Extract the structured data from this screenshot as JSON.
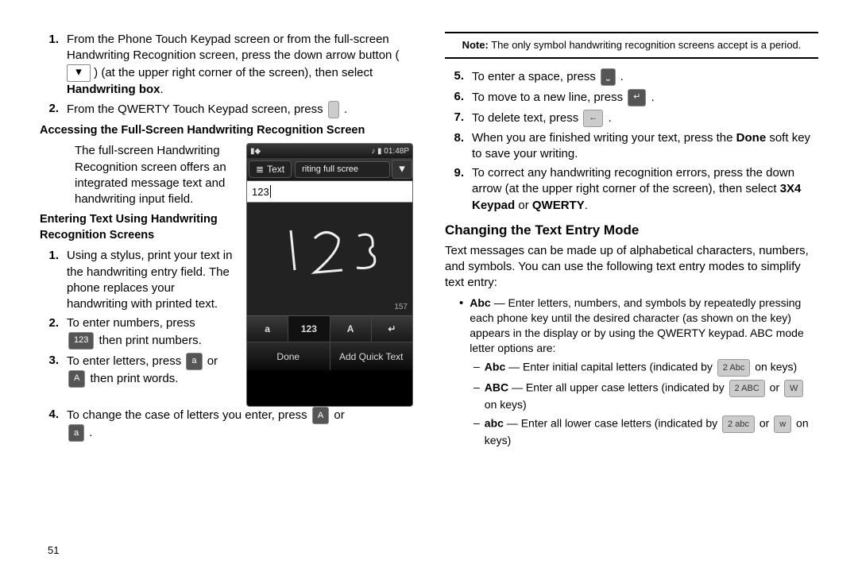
{
  "page_number": "51",
  "left": {
    "list1": {
      "i1": {
        "num": "1.",
        "text_a": "From the Phone Touch Keypad screen or from the full-screen Handwriting Recognition screen, press the down arrow button ( ",
        "text_b": " ) (at the upper right corner of the screen), then select ",
        "bold": "Handwriting box",
        "tail": "."
      },
      "i2": {
        "num": "2.",
        "text": "From the QWERTY Touch Keypad screen, press ",
        "tail": " ."
      }
    },
    "h_sub1": "Accessing the Full-Screen Handwriting Recognition Screen",
    "para1": "The full-screen Handwriting Recognition screen offers an integrated message text and handwriting input field.",
    "h_sub2": "Entering Text Using Handwriting Recognition Screens",
    "list2": {
      "i1": {
        "num": "1.",
        "text": "Using a stylus, print your text in the handwriting entry field. The phone replaces your handwriting with printed text."
      },
      "i2": {
        "num": "2.",
        "text_a": "To enter numbers, press ",
        "text_b": " then print numbers."
      },
      "i3": {
        "num": "3.",
        "text_a": "To enter letters, press ",
        "text_b": " or ",
        "text_c": " then print words."
      },
      "i4": {
        "num": "4.",
        "text_a": "To change the case of letters you enter, press ",
        "text_b": " or ",
        "text_c": " ."
      }
    },
    "phone": {
      "time": "01:48P",
      "tab1": "Text",
      "tab2": "riting full scree",
      "field": "123",
      "count": "157",
      "row2": {
        "a": "a",
        "b": "123",
        "c": "A",
        "d": "↵"
      },
      "row3": {
        "a": "Done",
        "b": "Add Quick Text"
      }
    },
    "icons": {
      "k123": "123",
      "ka": "a",
      "kA": "A"
    }
  },
  "right": {
    "note": {
      "label": "Note:",
      "text": " The only symbol handwriting recognition screens accept is a period."
    },
    "list": {
      "i5": {
        "num": "5.",
        "text": "To enter a space, press ",
        "tail": " ."
      },
      "i6": {
        "num": "6.",
        "text": "To move to a new line, press ",
        "tail": " ."
      },
      "i7": {
        "num": "7.",
        "text": "To delete text, press ",
        "tail": " ."
      },
      "i8": {
        "num": "8.",
        "text_a": "When you are finished writing your text, press the ",
        "bold": "Done",
        "text_b": " soft key to save your writing."
      },
      "i9": {
        "num": "9.",
        "text_a": "To correct any handwriting recognition errors, press the down arrow (at the upper right corner of the screen), then select ",
        "bold1": "3X4 Keypad",
        "mid": " or ",
        "bold2": "QWERTY",
        "tail": "."
      }
    },
    "h_sec": "Changing the Text Entry Mode",
    "para": "Text messages can be made up of alphabetical characters, numbers, and symbols. You can use the following text entry modes to simplify text entry:",
    "b1": {
      "bold": "Abc",
      "text": " — Enter letters, numbers, and symbols by repeatedly pressing each phone key until the desired character (as shown on the key) appears in the display or by using the QWERTY keypad. ABC mode letter options are:"
    },
    "s1": {
      "bold": "Abc",
      "text_a": " — Enter initial capital letters (indicated by ",
      "key": "2 Abc",
      "text_b": " on keys)"
    },
    "s2": {
      "bold": "ABC",
      "text_a": " — Enter all upper case letters (indicated by ",
      "key1": "2 ABC",
      "mid": " or ",
      "key2": "W",
      "text_b": " on keys)"
    },
    "s3": {
      "bold": "abc",
      "text_a": " — Enter all lower case letters (indicated by ",
      "key1": "2 abc",
      "mid": " or ",
      "key2": "w",
      "text_b": " on keys)"
    }
  }
}
